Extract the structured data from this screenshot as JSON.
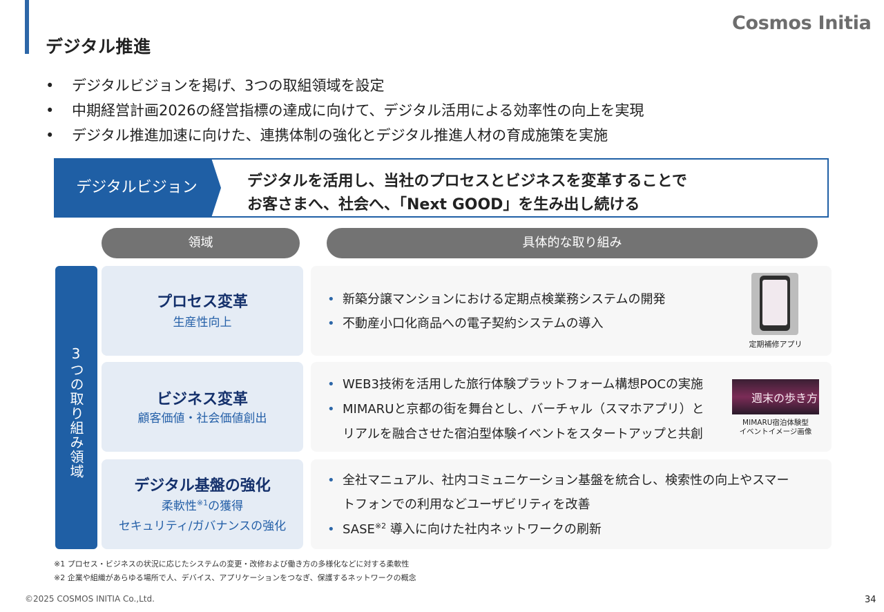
{
  "header": {
    "title": "デジタル推進",
    "logo": "Cosmos Initia"
  },
  "bullets": [
    "デジタルビジョンを掲げ、3つの取組領域を設定",
    "中期経営計画2026の経営指標の達成に向けて、デジタル活用による効率性の向上を実現",
    "デジタル推進加速に向けた、連携体制の強化とデジタル推進人材の育成施策を実施"
  ],
  "bullet_marker": "•",
  "vision": {
    "label": "デジタルビジョン",
    "line1": "デジタルを活用し、当社のプロセスとビジネスを変革することで",
    "line2": "お客さまへ、社会へ、「Next GOOD」を生み出し続ける"
  },
  "columns": {
    "area": "領域",
    "details": "具体的な取り組み"
  },
  "side_label": "3つの取り組み領域",
  "areas": [
    {
      "title": "プロセス変革",
      "sub": "生産性向上",
      "items": [
        "新築分譲マンションにおける定期点検業務システムの開発",
        "不動産小口化商品への電子契約システムの導入"
      ],
      "image_caption": "定期補修アプリ"
    },
    {
      "title": "ビジネス変革",
      "sub": "顧客価値・社会価値創出",
      "items": [
        "WEB3技術を活用した旅行体験プラットフォーム構想POCの実施",
        "MIMARUと京都の街を舞台とし、バーチャル（スマホアプリ）と",
        "リアルを融合させた宿泊型体験イベントをスタートアップと共創"
      ],
      "image_text": "週末の歩き方",
      "image_caption_1": "MIMARU宿泊体験型",
      "image_caption_2": "イベントイメージ画像"
    },
    {
      "title": "デジタル基盤の強化",
      "sub1_a": "柔軟性",
      "sub1_sup": "※1",
      "sub1_b": "の獲得",
      "sub2": "セキュリティ/ガバナンスの強化",
      "items": [
        "全社マニュアル、社内コミュニケーション基盤を統合し、検索性の向上やスマー",
        "トフォンでの利用などユーザビリティを改善"
      ],
      "item3_a": "SASE",
      "item3_sup": "※2",
      "item3_b": " 導入に向けた社内ネットワークの刷新"
    }
  ],
  "footnotes": [
    "※1  プロセス・ビジネスの状況に応じたシステムの変更・改修および働き方の多様化などに対する柔軟性",
    "※2  企業や組織があらゆる場所で人、デバイス、アプリケーションをつなぎ、保護するネットワークの概念"
  ],
  "footer": {
    "copyright": "©2025 COSMOS INITIA Co.,Ltd.",
    "page": "34"
  },
  "colors": {
    "primary": "#1f5fa5",
    "pill": "#737373",
    "area_bg": "#e5ecf5",
    "detail_bg": "#f7f7f7",
    "dark_navy": "#14306b"
  }
}
